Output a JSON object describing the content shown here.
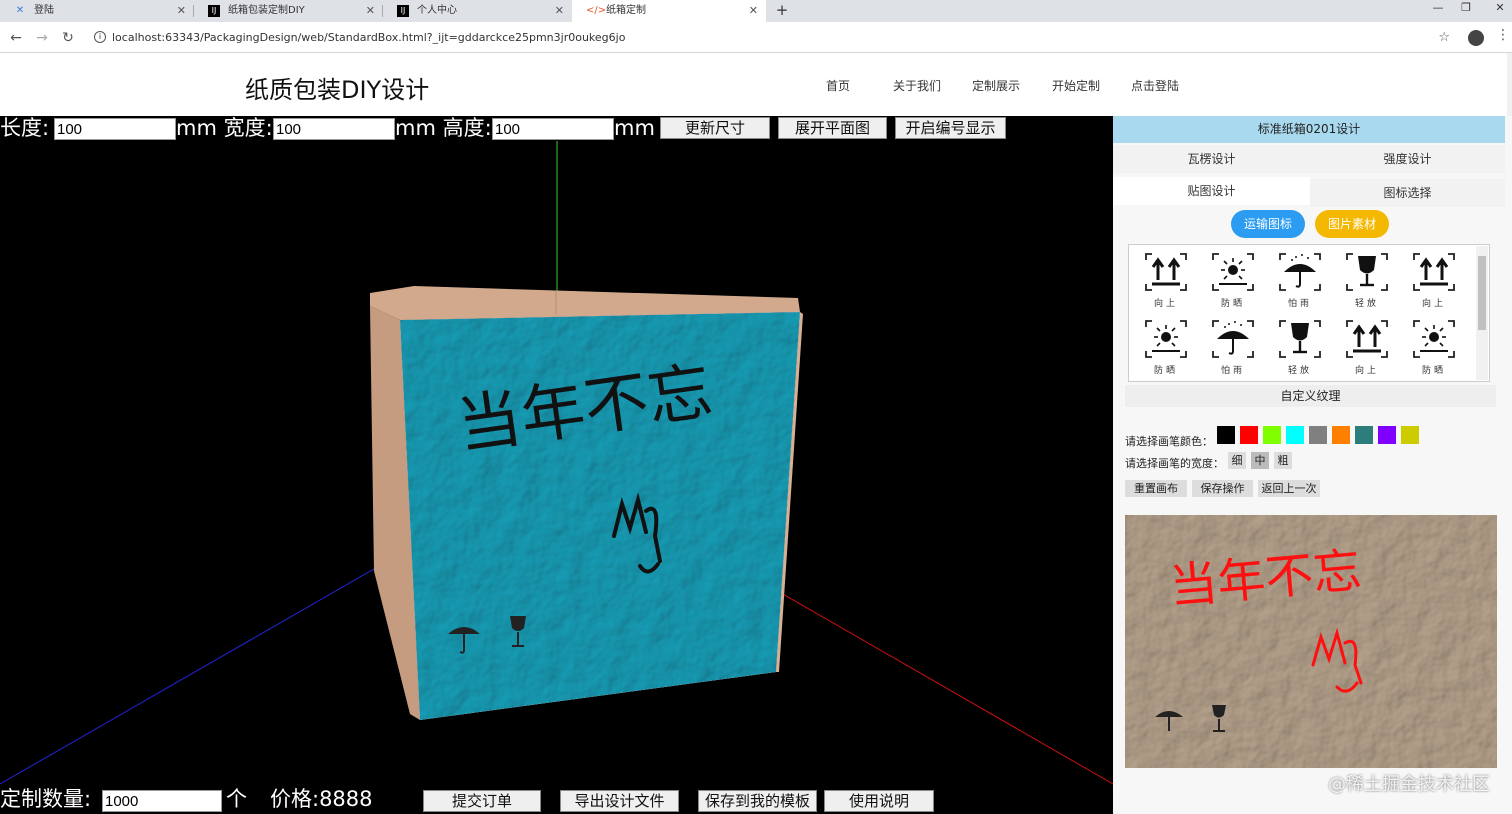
{
  "browser": {
    "tabs": [
      {
        "title": "登陆",
        "icon": "puzzle-icon"
      },
      {
        "title": "纸箱包装定制DIY",
        "icon": "intellij-icon"
      },
      {
        "title": "个人中心",
        "icon": "intellij-icon"
      },
      {
        "title": "纸箱定制",
        "icon": "code-icon"
      }
    ],
    "url": "localhost:63343/PackagingDesign/web/StandardBox.html?_ijt=gddarckce25pmn3jr0oukeg6jo"
  },
  "site": {
    "title": "纸质包装DIY设计",
    "nav": [
      "首页",
      "关于我们",
      "定制展示",
      "开始定制",
      "点击登陆"
    ]
  },
  "dimensions": {
    "length_label": "长度:",
    "length_value": "100",
    "width_label": "mm 宽度:",
    "width_value": "100",
    "height_label": "mm 高度:",
    "height_value": "100",
    "unit": "mm",
    "update_btn": "更新尺寸",
    "unfold_btn": "展开平面图",
    "numbering_btn": "开启编号显示"
  },
  "box_face": {
    "text": "当年不忘",
    "handwriting_color_canvas": "#111111",
    "face_color": "#1a9fb8",
    "side_color": "#c9a186"
  },
  "order": {
    "qty_label": "定制数量:",
    "qty_value": "1000",
    "qty_unit": "个",
    "price_label": "价格:8888",
    "submit_btn": "提交订单",
    "export_btn": "导出设计文件",
    "save_template_btn": "保存到我的模板",
    "help_btn": "使用说明"
  },
  "panel": {
    "title": "标准纸箱0201设计",
    "tabs": [
      "瓦楞设计",
      "强度设计",
      "贴图设计",
      "图标选择"
    ],
    "pill_transport": "运输图标",
    "pill_images": "图片素材",
    "pill_transport_color": "#2b9cf2",
    "pill_images_color": "#f5b800",
    "icons_row1": [
      {
        "type": "up",
        "caption": "向上"
      },
      {
        "type": "sun",
        "caption": "防晒"
      },
      {
        "type": "rain",
        "caption": "怕雨"
      },
      {
        "type": "fragile",
        "caption": "轻放"
      },
      {
        "type": "up",
        "caption": "向上"
      }
    ],
    "icons_row2": [
      {
        "type": "sun",
        "caption": "防晒"
      },
      {
        "type": "rain",
        "caption": "怕雨"
      },
      {
        "type": "fragile",
        "caption": "轻放"
      },
      {
        "type": "up",
        "caption": "向上"
      },
      {
        "type": "sun",
        "caption": "防晒"
      }
    ],
    "custom_texture": "自定义纹理",
    "pen_color_label": "请选择画笔颜色：",
    "pen_colors": [
      "#000000",
      "#ff0000",
      "#7fff00",
      "#00ffff",
      "#808080",
      "#ff8000",
      "#2e7d7d",
      "#8000ff",
      "#cccc00"
    ],
    "pen_width_label": "请选择画笔的宽度：",
    "pen_widths": [
      "细",
      "中",
      "粗"
    ],
    "reset_btn": "重置画布",
    "save_btn": "保存操作",
    "undo_btn": "返回上一次",
    "canvas_text": "当年不忘",
    "canvas_ink_color": "#ff1010",
    "texture_color": "#b8a48e"
  },
  "watermark": "@稀土掘金技术社区"
}
